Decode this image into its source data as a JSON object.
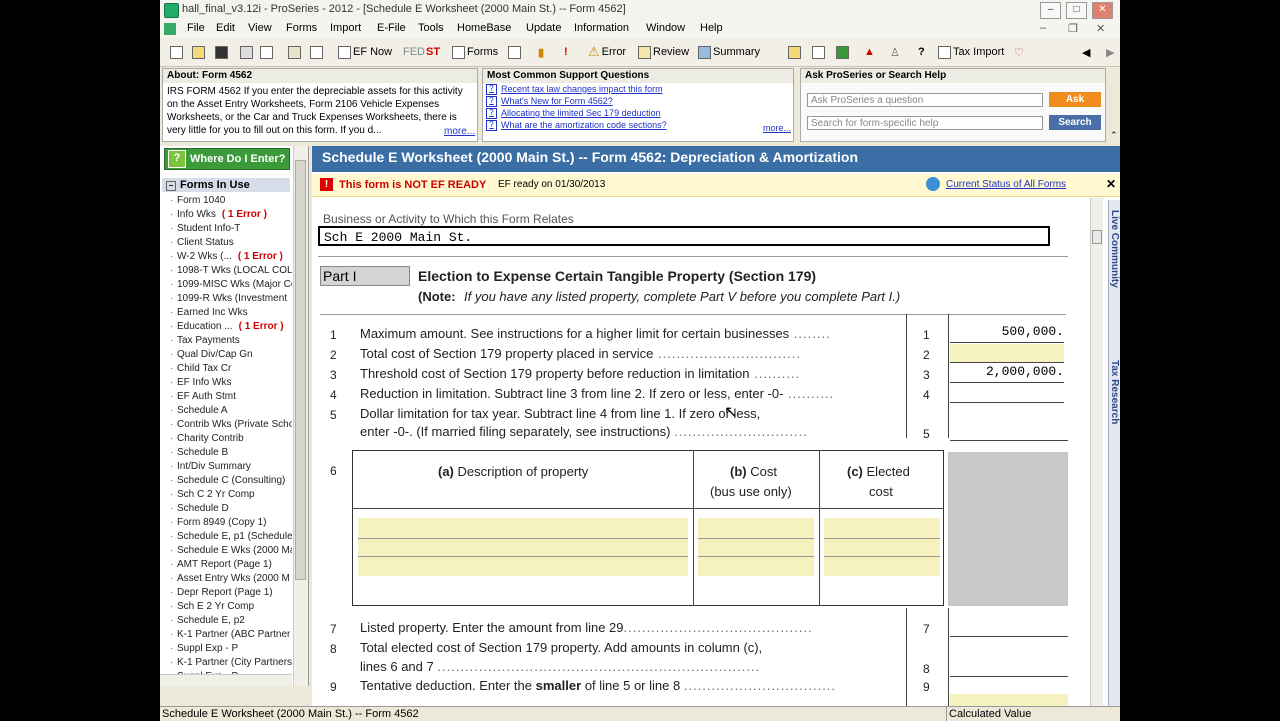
{
  "window": {
    "title": "hall_final_v3.12i - ProSeries - 2012 - [Schedule E Worksheet (2000 Main St.) -- Form 4562]"
  },
  "menu": [
    "File",
    "Edit",
    "View",
    "Forms",
    "Import",
    "E-File",
    "Tools",
    "HomeBase",
    "Update",
    "Information",
    "Window",
    "Help"
  ],
  "toolbar": {
    "ef_now": "EF Now",
    "fed": "FED",
    "st": "ST",
    "forms": "Forms",
    "error": "Error",
    "review": "Review",
    "summary": "Summary",
    "tax_import": "Tax Import"
  },
  "about": {
    "header": "About: Form 4562",
    "text": "IRS FORM 4562  If you enter the depreciable assets for this activity on the Asset Entry Worksheets, Form 2106 Vehicle Expenses Worksheets, or the Car and Truck Expenses Worksheets, there is very little for you to fill out on this form.  If you d...",
    "more": "more..."
  },
  "support": {
    "header": "Most Common Support Questions",
    "questions": [
      "Recent tax law changes impact this form",
      "What's New for Form 4562?",
      "Allocating the limited Sec 179 deduction",
      "What are the amortization code sections?"
    ],
    "more": "more..."
  },
  "ask": {
    "header": "Ask ProSeries or Search Help",
    "question_placeholder": "Ask ProSeries a question",
    "ask_label": "Ask",
    "search_placeholder": "Search for form-specific help",
    "search_label": "Search"
  },
  "sidebar": {
    "where_label": "Where Do I Enter?",
    "forms_header": "Forms In Use",
    "items": [
      {
        "label": "Form 1040",
        "err": ""
      },
      {
        "label": "Info Wks",
        "err": "( 1 Error )"
      },
      {
        "label": "Student Info-T",
        "err": ""
      },
      {
        "label": "Client Status",
        "err": ""
      },
      {
        "label": "W-2 Wks (...",
        "err": "( 1 Error )"
      },
      {
        "label": "1098-T Wks (LOCAL COL",
        "err": ""
      },
      {
        "label": "1099-MISC Wks (Major Co",
        "err": ""
      },
      {
        "label": "1099-R Wks (Investment",
        "err": ""
      },
      {
        "label": "Earned Inc Wks",
        "err": ""
      },
      {
        "label": "Education ...",
        "err": "( 1 Error )"
      },
      {
        "label": "Tax Payments",
        "err": ""
      },
      {
        "label": "Qual Div/Cap Gn",
        "err": ""
      },
      {
        "label": "Child Tax Cr",
        "err": ""
      },
      {
        "label": "EF Info Wks",
        "err": ""
      },
      {
        "label": "EF Auth Stmt",
        "err": ""
      },
      {
        "label": "Schedule A",
        "err": ""
      },
      {
        "label": "Contrib Wks (Private Scho",
        "err": ""
      },
      {
        "label": "Charity Contrib",
        "err": ""
      },
      {
        "label": "Schedule B",
        "err": ""
      },
      {
        "label": "Int/Div Summary",
        "err": ""
      },
      {
        "label": "Schedule C (Consulting)",
        "err": ""
      },
      {
        "label": "Sch C 2 Yr Comp",
        "err": ""
      },
      {
        "label": "Schedule D",
        "err": ""
      },
      {
        "label": "Form 8949 (Copy 1)",
        "err": ""
      },
      {
        "label": "Schedule E, p1 (Schedule",
        "err": ""
      },
      {
        "label": "Schedule E Wks (2000 Ma",
        "err": ""
      },
      {
        "label": "AMT Report (Page 1)",
        "err": ""
      },
      {
        "label": "Asset Entry Wks (2000 M",
        "err": ""
      },
      {
        "label": "Depr Report (Page 1)",
        "err": ""
      },
      {
        "label": "Sch E 2 Yr Comp",
        "err": ""
      },
      {
        "label": "Schedule E, p2",
        "err": ""
      },
      {
        "label": "K-1 Partner (ABC Partner",
        "err": ""
      },
      {
        "label": "Suppl Exp - P",
        "err": ""
      },
      {
        "label": "K-1 Partner (City Partners",
        "err": ""
      },
      {
        "label": "Suppl Exp - P",
        "err": ""
      }
    ]
  },
  "main": {
    "header": "Schedule E Worksheet (2000 Main St.) -- Form 4562: Depreciation & Amortization",
    "ef_status": "This form is NOT EF READY",
    "ef_ready": "EF ready on 01/30/2013",
    "current_status": "Current Status of All Forms",
    "business_label": "Business or Activity to Which this Form Relates",
    "business_value": "Sch E 2000 Main St.",
    "part_label": "Part I",
    "part_title": "Election to Expense Certain Tangible Property (Section 179)",
    "note_bold": "(Note:",
    "note_text": "If you have any listed property, complete Part V before you complete Part I.)",
    "lines": [
      {
        "n": "1",
        "text": "Maximum amount. See instructions for a higher limit for  certain businesses",
        "box": "1",
        "value": "500,000."
      },
      {
        "n": "2",
        "text": "Total cost of Section 179 property placed in service",
        "box": "2",
        "value": ""
      },
      {
        "n": "3",
        "text": "Threshold cost of Section 179 property before reduction in limitation",
        "box": "3",
        "value": "2,000,000."
      },
      {
        "n": "4",
        "text": "Reduction in limitation. Subtract line 3 from line 2. If zero or less, enter -0-",
        "box": "4",
        "value": ""
      },
      {
        "n": "5",
        "text": "Dollar limitation for tax year. Subtract line 4 from line 1. If zero or less,",
        "box": "",
        "value": ""
      }
    ],
    "line5b": "enter -0-. (If married filing separately, see instructions)",
    "line5box": "5",
    "line6": "6",
    "col_a_bold": "(a)",
    "col_a": "Description of property",
    "col_b_bold": "(b)",
    "col_b1": "Cost",
    "col_b2": "(bus use only)",
    "col_c_bold": "(c)",
    "col_c1": "Elected",
    "col_c2": "cost",
    "line7n": "7",
    "line7": "Listed property. Enter the amount from line 29",
    "line7box": "7",
    "line8n": "8",
    "line8a": "Total elected cost of Section 179 property. Add amounts in column (c),",
    "line8b": "lines 6 and 7",
    "line8box": "8",
    "line9n": "9",
    "line9a": "Tentative deduction. Enter the",
    "line9bold": "smaller",
    "line9b": "of line 5 or line 8",
    "line9box": "9"
  },
  "right_tabs": {
    "community": "Live Community",
    "research": "Tax Research"
  },
  "status_bar": {
    "left": "Schedule E Worksheet (2000 Main St.) -- Form 4562",
    "right": "Calculated Value"
  }
}
